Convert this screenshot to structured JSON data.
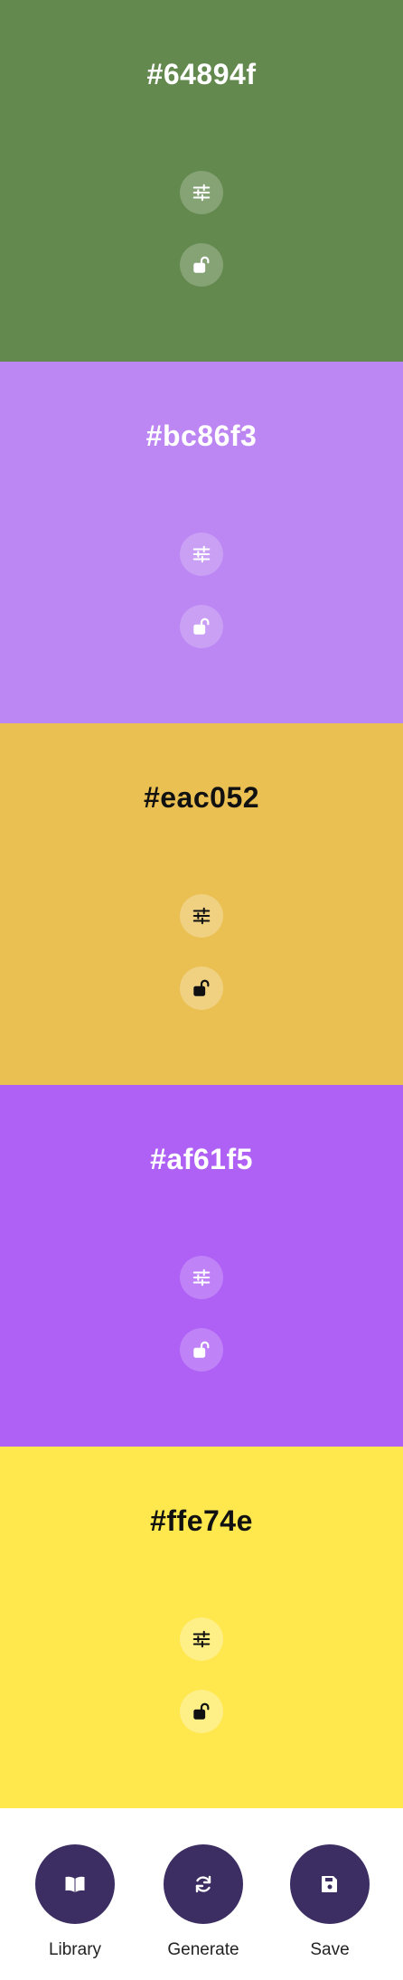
{
  "swatches": [
    {
      "hex": "#64894f",
      "color": "#64894f",
      "text_color": "#ffffff",
      "button_bg": "rgba(255,255,255,0.22)",
      "icon_color": "#ffffff"
    },
    {
      "hex": "#bc86f3",
      "color": "#bc86f3",
      "text_color": "#ffffff",
      "button_bg": "rgba(255,255,255,0.22)",
      "icon_color": "#ffffff"
    },
    {
      "hex": "#eac052",
      "color": "#eac052",
      "text_color": "#111111",
      "button_bg": "rgba(255,255,255,0.28)",
      "icon_color": "#111111"
    },
    {
      "hex": "#af61f5",
      "color": "#af61f5",
      "text_color": "#ffffff",
      "button_bg": "rgba(255,255,255,0.22)",
      "icon_color": "#ffffff"
    },
    {
      "hex": "#ffe74e",
      "color": "#ffe74e",
      "text_color": "#111111",
      "button_bg": "rgba(255,255,255,0.32)",
      "icon_color": "#111111"
    }
  ],
  "swatch_icons": {
    "adjust": "sliders-icon",
    "lock": "unlock-icon"
  },
  "actions": {
    "library": {
      "label": "Library",
      "icon": "book-open-icon"
    },
    "generate": {
      "label": "Generate",
      "icon": "refresh-icon"
    },
    "save": {
      "label": "Save",
      "icon": "floppy-disk-icon"
    }
  },
  "colors": {
    "action_button": "#3c2e63",
    "action_icon": "#ffffff",
    "bottom_bar_bg": "#ffffff"
  }
}
